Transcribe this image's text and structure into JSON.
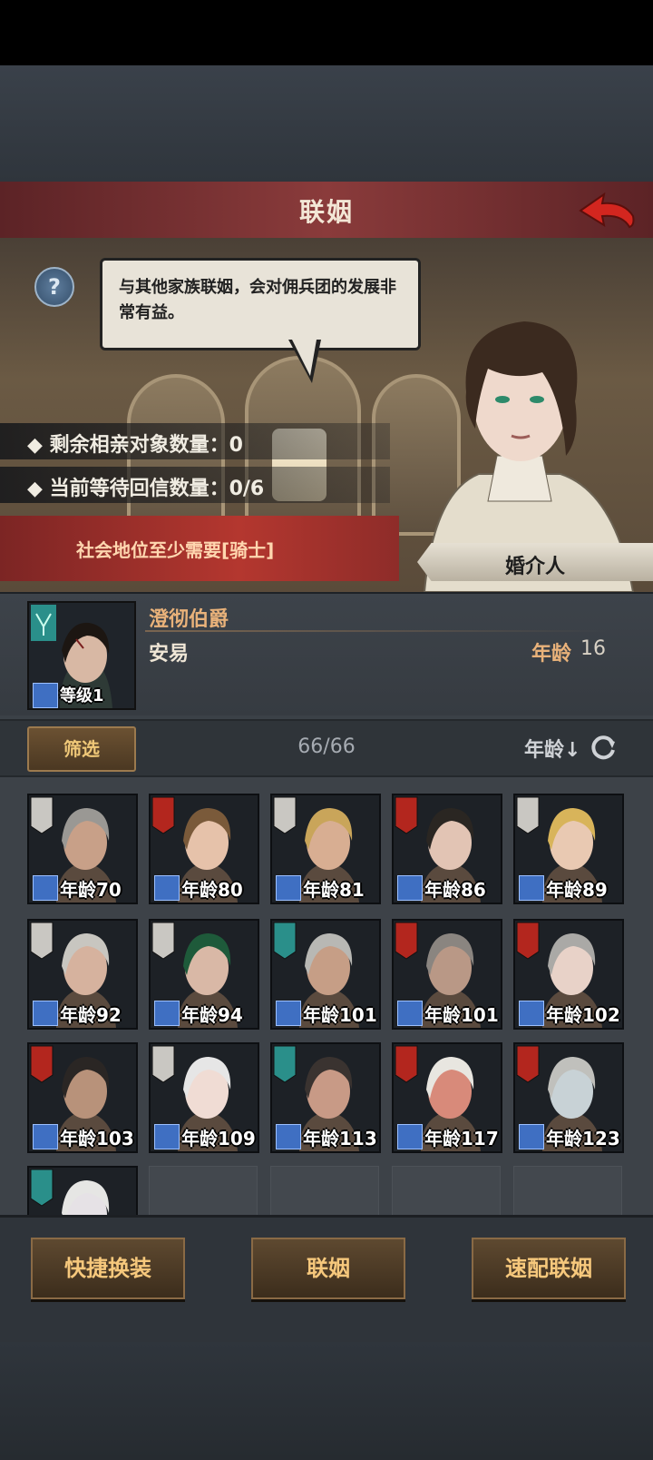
{
  "header": {
    "title": "联姻"
  },
  "intro": {
    "help_icon": "question-icon",
    "speech": "与其他家族联姻，会对佣兵团的发展非常有益。"
  },
  "stats": {
    "remaining_label": "◆ 剩余相亲对象数量：0",
    "waiting_label": "◆ 当前等待回信数量：0/6"
  },
  "status": {
    "requirement": "社会地位至少需要[骑士]"
  },
  "matchmaker": {
    "label": "婚介人"
  },
  "player": {
    "title": "澄彻伯爵",
    "trait": "安易",
    "age_label": "年龄",
    "age": "16",
    "level": "等级1"
  },
  "filter": {
    "button": "筛选",
    "count": "66/66",
    "sort": "年龄↓"
  },
  "candidates": [
    {
      "age": "年龄70",
      "badge": "grey"
    },
    {
      "age": "年龄80",
      "badge": "red"
    },
    {
      "age": "年龄81",
      "badge": "grey"
    },
    {
      "age": "年龄86",
      "badge": "red"
    },
    {
      "age": "年龄89",
      "badge": "grey"
    },
    {
      "age": "年龄92",
      "badge": "grey"
    },
    {
      "age": "年龄94",
      "badge": "grey"
    },
    {
      "age": "年龄101",
      "badge": "teal"
    },
    {
      "age": "年龄101",
      "badge": "red"
    },
    {
      "age": "年龄102",
      "badge": "red"
    },
    {
      "age": "年龄103",
      "badge": "red"
    },
    {
      "age": "年龄109",
      "badge": "grey"
    },
    {
      "age": "年龄113",
      "badge": "teal"
    },
    {
      "age": "年龄117",
      "badge": "red"
    },
    {
      "age": "年龄123",
      "badge": "red"
    },
    {
      "age": "",
      "badge": "teal"
    }
  ],
  "buttons": {
    "quick_equip": "快捷换装",
    "marry": "联姻",
    "auto_marry": "速配联姻"
  },
  "colors": {
    "grey": "#c9c7c2",
    "red": "#b3261e",
    "teal": "#2a8f8a"
  }
}
